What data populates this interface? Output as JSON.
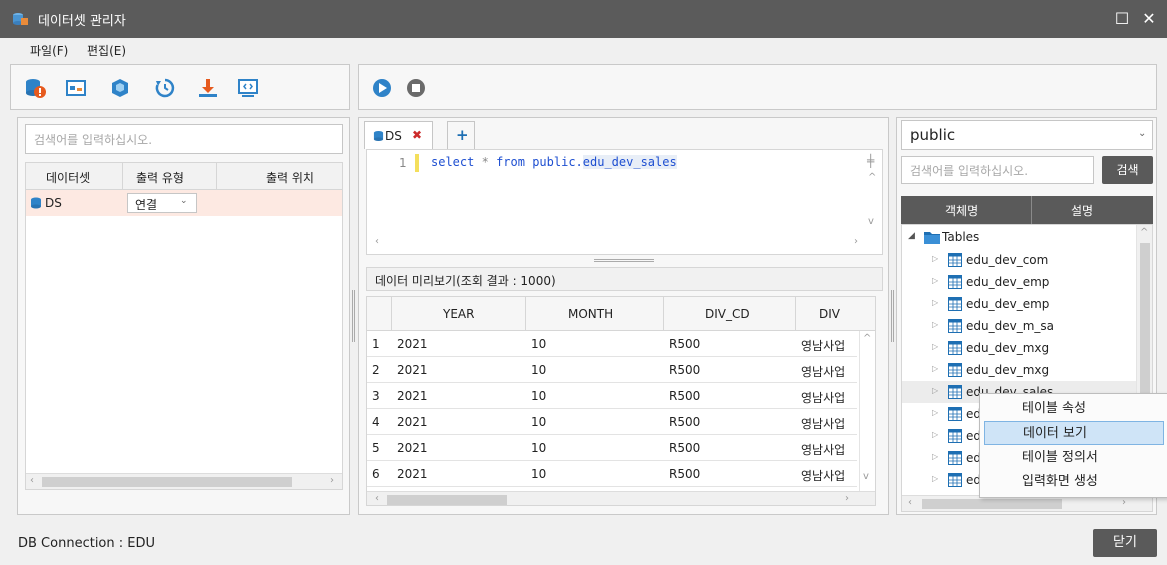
{
  "window": {
    "title": "데이터셋 관리자",
    "maximize_glyph": "☐",
    "close_glyph": "✕"
  },
  "menu": {
    "file": "파일(F)",
    "edit": "편집(E)"
  },
  "toolbar_left_icons": [
    "dataset-error-icon",
    "image-icon",
    "cube-icon",
    "history-icon",
    "download-icon",
    "code-icon"
  ],
  "toolbar_right_icons": [
    "run-icon",
    "stop-icon"
  ],
  "left": {
    "search_placeholder": "검색어를 입력하십시오.",
    "columns": [
      "데이터셋",
      "출력 유형",
      "출력 위치"
    ],
    "rows": [
      {
        "name": "DS",
        "output_type": "연결",
        "output_location": ""
      }
    ]
  },
  "center": {
    "tab_label": "DS",
    "tab_close": "✖",
    "add_tab": "+",
    "editor": {
      "line_number": "1",
      "kw_select": "select",
      "star": "*",
      "kw_from": "from",
      "schema": "public.",
      "table": "edu_dev_sales"
    },
    "preview_label": "데이터 미리보기(조회 결과 : 1000)",
    "preview_columns": [
      "YEAR",
      "MONTH",
      "DIV_CD",
      "DIV"
    ],
    "preview_rows": [
      {
        "n": "1",
        "year": "2021",
        "month": "10",
        "div_cd": "R500",
        "div": "영남사업"
      },
      {
        "n": "2",
        "year": "2021",
        "month": "10",
        "div_cd": "R500",
        "div": "영남사업"
      },
      {
        "n": "3",
        "year": "2021",
        "month": "10",
        "div_cd": "R500",
        "div": "영남사업"
      },
      {
        "n": "4",
        "year": "2021",
        "month": "10",
        "div_cd": "R500",
        "div": "영남사업"
      },
      {
        "n": "5",
        "year": "2021",
        "month": "10",
        "div_cd": "R500",
        "div": "영남사업"
      },
      {
        "n": "6",
        "year": "2021",
        "month": "10",
        "div_cd": "R500",
        "div": "영남사업"
      }
    ]
  },
  "right": {
    "schema": "public",
    "search_placeholder": "검색어를 입력하십시오.",
    "search_button": "검색",
    "columns": [
      "객체명",
      "설명"
    ],
    "tree_root": "Tables",
    "tables": [
      "edu_dev_com",
      "edu_dev_emp",
      "edu_dev_emp",
      "edu_dev_m_sa",
      "edu_dev_mxg",
      "edu_dev_mxg",
      "edu_dev_sales",
      "ed",
      "ed",
      "ed",
      "ed"
    ]
  },
  "context_menu": {
    "items": [
      "테이블 속성",
      "데이터 보기",
      "테이블 정의서",
      "입력화면 생성"
    ],
    "selected_index": 1
  },
  "status": {
    "connection": "DB Connection : EDU"
  },
  "footer": {
    "close_button": "닫기"
  },
  "colors": {
    "titlebar": "#5b5b5b",
    "accent_blue": "#1e6fb3",
    "selection": "#cfe4f7",
    "row_highlight": "#fde9e2",
    "close_red": "#cc2b2b"
  }
}
